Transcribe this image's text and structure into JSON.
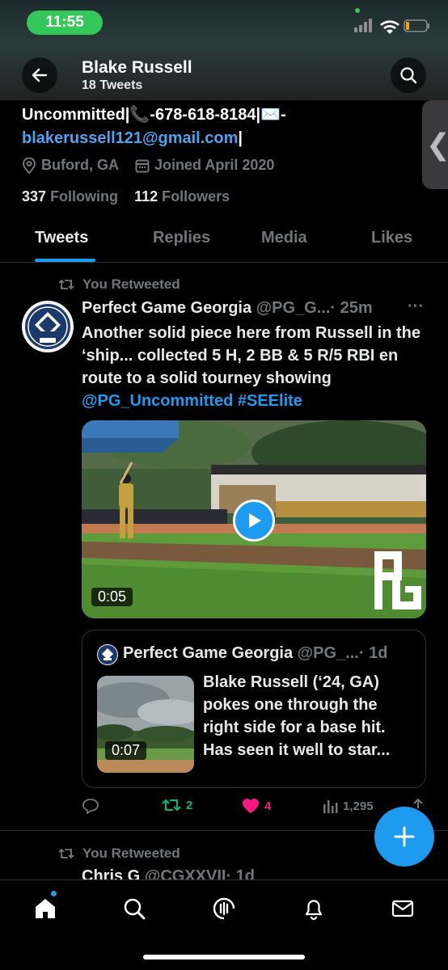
{
  "status_bar": {
    "time": "11:55"
  },
  "header": {
    "name": "Blake Russell",
    "tweet_count": "18 Tweets"
  },
  "bio": {
    "line1": "Uncommitted|📞-678-618-8184|✉️-",
    "email": "blakerussell121@gmail.com",
    "trail": "|"
  },
  "meta": {
    "location": "Buford, GA",
    "joined": "Joined April 2020"
  },
  "follow": {
    "following_count": "337",
    "following_label": "Following",
    "followers_count": "112",
    "followers_label": "Followers"
  },
  "tabs": [
    {
      "label": "Tweets",
      "active": true
    },
    {
      "label": "Replies"
    },
    {
      "label": "Media"
    },
    {
      "label": "Likes"
    }
  ],
  "tweet": {
    "retweet_label": "You Retweeted",
    "author_name": "Perfect Game Georgia",
    "author_handle": "@PG_G...",
    "time": "· 25m",
    "more": "···",
    "text": "Another solid piece here from Russell in the ‘ship... collected 5 H, 2 BB & 5 R/5 RBI en route to a solid tourney showing ",
    "mention": "@PG_Uncommitted",
    "hashtag": "#SEElite",
    "video_duration": "0:05",
    "quote": {
      "author_name": "Perfect Game Georgia",
      "author_handle": "@PG_...",
      "time": "· 1d",
      "text": "Blake Russell (‘24, GA) pokes one through the right side for a base hit. Has seen it well to star...",
      "video_duration": "0:07"
    },
    "actions": {
      "replies": "",
      "retweets": "2",
      "likes": "4",
      "views": "1,295"
    }
  },
  "next_tweet": {
    "retweet_label": "You Retweeted",
    "author_name": "Chris G",
    "author_handle": "@CGXXVII",
    "time": "· 1d"
  },
  "colors": {
    "accent": "#1d9bf0",
    "like": "#f91880",
    "retweet": "#00ba7c",
    "muted": "#71767b"
  },
  "icons": [
    "back-arrow-icon",
    "search-icon",
    "location-pin-icon",
    "calendar-icon",
    "retweet-icon",
    "reply-icon",
    "like-icon",
    "views-icon",
    "share-icon",
    "compose-icon",
    "home-icon",
    "spaces-icon",
    "bell-icon",
    "mail-icon"
  ]
}
